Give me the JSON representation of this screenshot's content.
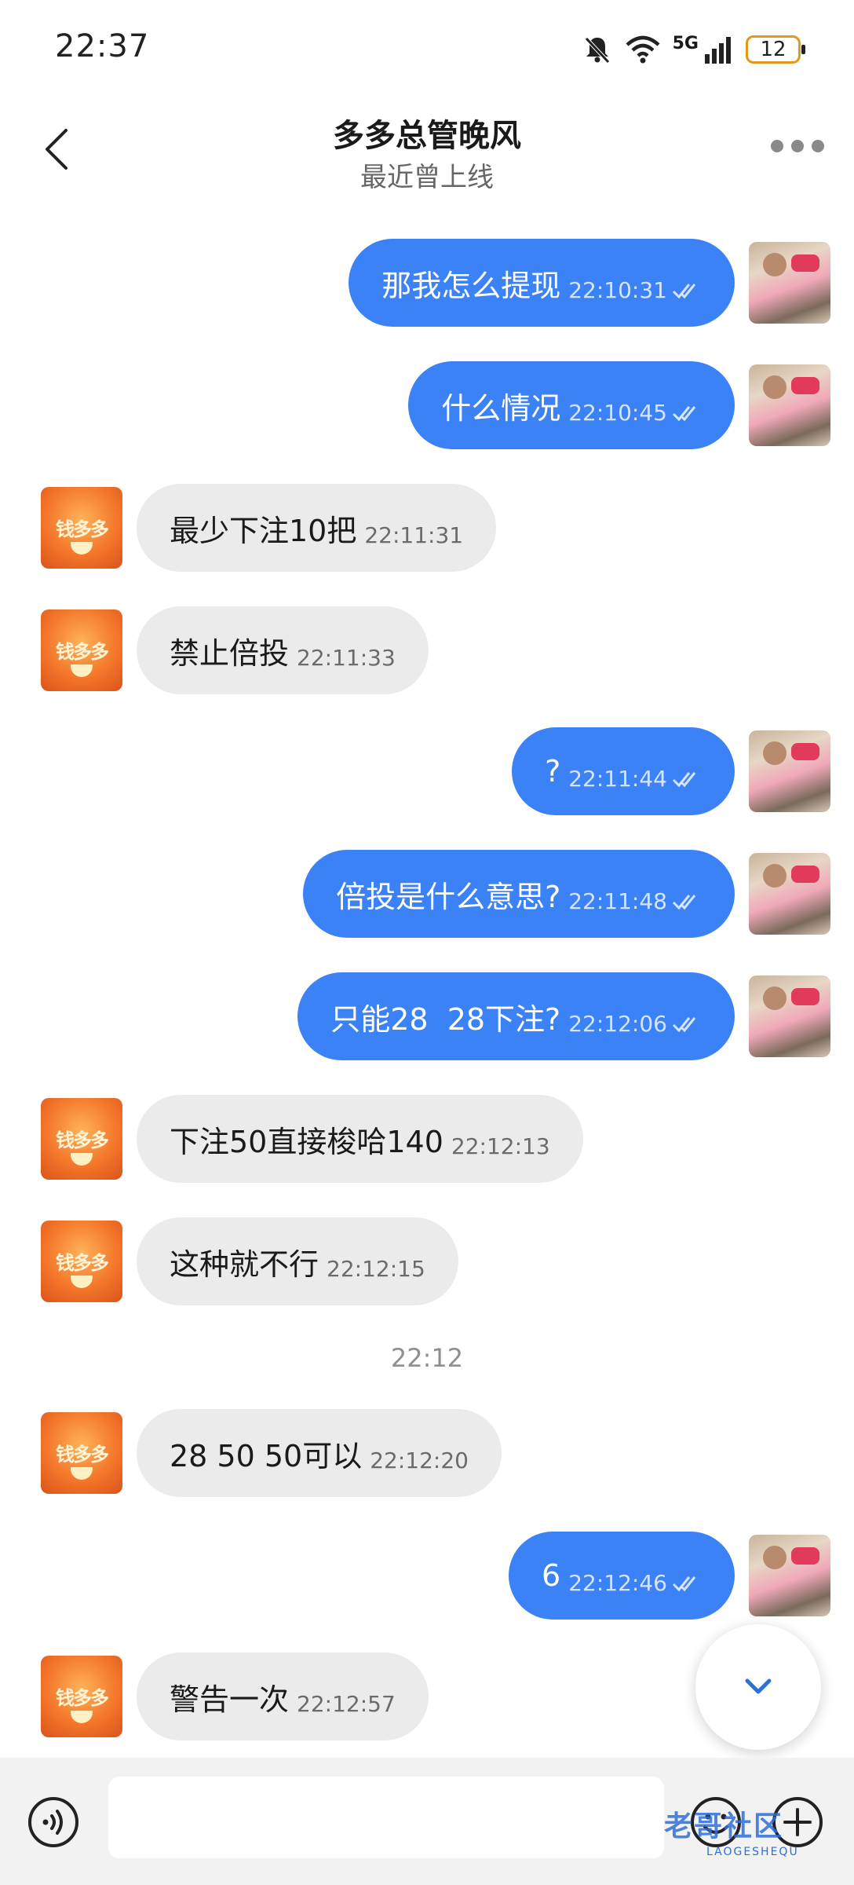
{
  "status_bar": {
    "time": "22:37",
    "network": "5G",
    "battery": "12",
    "icons": [
      "bell-muted-icon",
      "wifi-icon",
      "signal-icon",
      "battery-icon"
    ]
  },
  "header": {
    "title": "多多总管晚风",
    "subtitle": "最近曾上线"
  },
  "messages": [
    {
      "side": "out",
      "text": "那我怎么提现",
      "time": "22:10:31"
    },
    {
      "side": "out",
      "text": "什么情况",
      "time": "22:10:45"
    },
    {
      "side": "in",
      "text": "最少下注10把",
      "time": "22:11:31"
    },
    {
      "side": "in",
      "text": "禁止倍投",
      "time": "22:11:33"
    },
    {
      "side": "out",
      "text": "?",
      "time": "22:11:44"
    },
    {
      "side": "out",
      "text": "倍投是什么意思?",
      "time": "22:11:48"
    },
    {
      "side": "out",
      "text": "只能28  28下注?",
      "time": "22:12:06"
    },
    {
      "side": "in",
      "text": "下注50直接梭哈140",
      "time": "22:12:13"
    },
    {
      "side": "in",
      "text": "这种就不行",
      "time": "22:12:15"
    },
    {
      "side": "in",
      "text": "28 50 50可以",
      "time": "22:12:20"
    },
    {
      "side": "out",
      "text": "6",
      "time": "22:12:46"
    },
    {
      "side": "in",
      "text": "警告一次",
      "time": "22:12:57"
    }
  ],
  "time_divider": "22:12",
  "input": {
    "placeholder": ""
  },
  "watermark": {
    "text": "老哥社区",
    "sub": "LAOGESHEQU"
  },
  "colors": {
    "outgoing_bubble": "#3b82f6",
    "incoming_bubble": "#ebebeb",
    "accent": "#2f6fd8"
  }
}
